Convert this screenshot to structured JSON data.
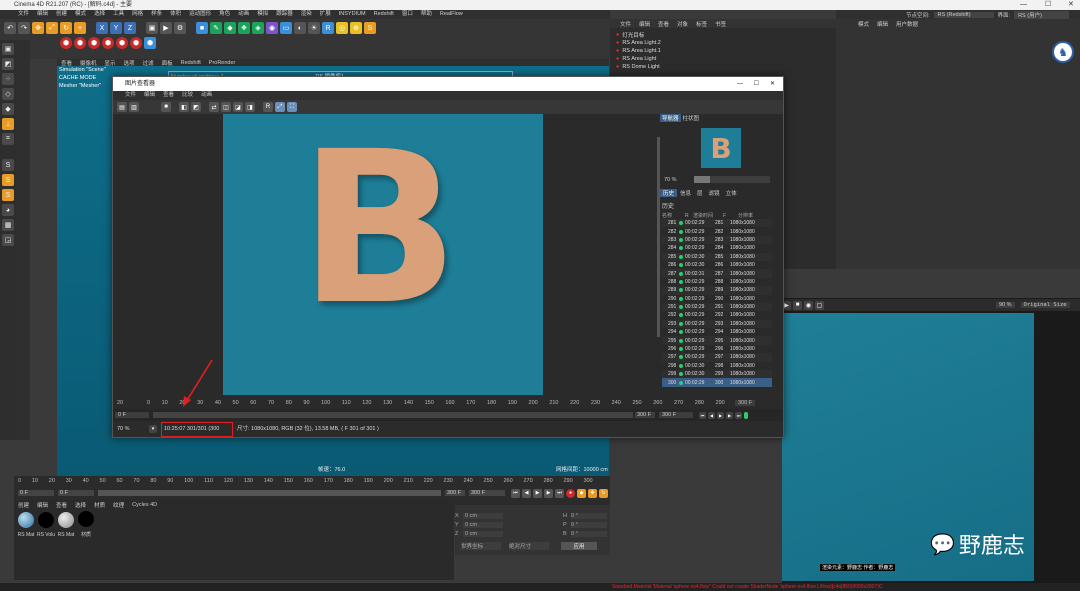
{
  "app": {
    "title": "Cinema 4D R21.207 (RC) - [解码.c4d] - 主要",
    "menus": [
      "文件",
      "编辑",
      "创建",
      "模式",
      "选择",
      "工具",
      "网格",
      "样条",
      "体积",
      "运动图形",
      "角色",
      "动画",
      "模拟",
      "跟踪器",
      "渲染",
      "扩展",
      "INSYDIUM",
      "Redshift",
      "窗口",
      "帮助",
      "RealFlow"
    ],
    "layout_label": "节点空间:",
    "layout_value": "RS (Redshift)",
    "interface_label": "界面:",
    "interface_value": "RS (用户)"
  },
  "viewport": {
    "menu": [
      "查看",
      "摄像机",
      "显示",
      "选项",
      "过滤",
      "面板",
      "Redshift",
      "ProRender"
    ],
    "info_lines": [
      "Simulation \"Scene\"",
      "CACHE MODE",
      "Mesher \"Mesher\""
    ],
    "overlay_emitters": "Number of emitters: 1",
    "overlay_cam": "RS 摄像机1",
    "speed": "帧速：76.0",
    "grid": "网格间距：10000 cm"
  },
  "timeline": {
    "ticks": [
      "0",
      "10",
      "20",
      "30",
      "40",
      "50",
      "60",
      "70",
      "80",
      "90",
      "100",
      "110",
      "120",
      "130",
      "140",
      "150",
      "160",
      "170",
      "180",
      "190",
      "200",
      "210",
      "220",
      "230",
      "240",
      "250",
      "260",
      "270",
      "280",
      "290",
      "300"
    ],
    "start": "0 F",
    "min": "0 F",
    "max": "300 F",
    "end": "300 F"
  },
  "materials": {
    "menu": [
      "创建",
      "编辑",
      "查看",
      "选择",
      "材质",
      "纹理",
      "Cycles 4D"
    ],
    "items": [
      "RS Mat",
      "RS Volu",
      "RS Mat",
      "材质"
    ]
  },
  "coords": {
    "labels": [
      "X",
      "Y",
      "Z"
    ],
    "values": [
      "0 cm",
      "0 cm",
      "0 cm"
    ],
    "size_labels": [
      "H",
      "P",
      "B"
    ],
    "size_values": [
      "0 °",
      "0 °",
      "0 °"
    ],
    "mode": "世界坐标",
    "scale": "绝对尺寸",
    "apply": "应用"
  },
  "objects": {
    "menu": [
      "文件",
      "编辑",
      "查看",
      "对象",
      "标签",
      "书签"
    ],
    "items": [
      "灯光目标",
      "RS Area Light.2",
      "RS Area Light.1",
      "RS Area Light",
      "RS Dome Light"
    ]
  },
  "attributes": {
    "menu": [
      "模式",
      "编辑",
      "用户数据"
    ]
  },
  "picture_viewer": {
    "title": "图片查看器",
    "menu": [
      "文件",
      "编辑",
      "查看",
      "比较",
      "动画"
    ],
    "zoom": "70 %",
    "side_tabs": [
      "导航器",
      "柱状图"
    ],
    "side_zoom": "70 %",
    "history_tabs": [
      "历史",
      "信息",
      "层",
      "滤镜",
      "立体"
    ],
    "history_label": "历史",
    "history_headers": [
      "名称",
      "R",
      "渲染时间",
      "F",
      "分辨率"
    ],
    "history": [
      {
        "id": "281",
        "time": "00:02:29",
        "f": "281",
        "res": "1080x1080"
      },
      {
        "id": "282",
        "time": "00:02:29",
        "f": "282",
        "res": "1080x1080"
      },
      {
        "id": "283",
        "time": "00:02:29",
        "f": "283",
        "res": "1080x1080"
      },
      {
        "id": "284",
        "time": "00:02:29",
        "f": "284",
        "res": "1080x1080"
      },
      {
        "id": "285",
        "time": "00:02:30",
        "f": "285",
        "res": "1080x1080"
      },
      {
        "id": "286",
        "time": "00:02:30",
        "f": "286",
        "res": "1080x1080"
      },
      {
        "id": "287",
        "time": "00:02:31",
        "f": "287",
        "res": "1080x1080"
      },
      {
        "id": "288",
        "time": "00:02:29",
        "f": "288",
        "res": "1080x1080"
      },
      {
        "id": "289",
        "time": "00:02:29",
        "f": "289",
        "res": "1080x1080"
      },
      {
        "id": "290",
        "time": "00:02:29",
        "f": "290",
        "res": "1080x1080"
      },
      {
        "id": "291",
        "time": "00:02:29",
        "f": "291",
        "res": "1080x1080"
      },
      {
        "id": "292",
        "time": "00:02:29",
        "f": "292",
        "res": "1080x1080"
      },
      {
        "id": "293",
        "time": "00:02:29",
        "f": "293",
        "res": "1080x1080"
      },
      {
        "id": "294",
        "time": "00:02:29",
        "f": "294",
        "res": "1080x1080"
      },
      {
        "id": "295",
        "time": "00:02:29",
        "f": "295",
        "res": "1080x1080"
      },
      {
        "id": "296",
        "time": "00:02:29",
        "f": "296",
        "res": "1080x1080"
      },
      {
        "id": "297",
        "time": "00:02:29",
        "f": "297",
        "res": "1080x1080"
      },
      {
        "id": "298",
        "time": "00:02:30",
        "f": "298",
        "res": "1080x1080"
      },
      {
        "id": "299",
        "time": "00:02:30",
        "f": "299",
        "res": "1080x1080"
      },
      {
        "id": "300",
        "time": "00:02:29",
        "f": "300",
        "res": "1080x1080"
      }
    ],
    "tl_ticks": [
      "0",
      "10",
      "20",
      "30",
      "40",
      "50",
      "60",
      "70",
      "80",
      "90",
      "100",
      "110",
      "120",
      "130",
      "140",
      "150",
      "160",
      "170",
      "180",
      "190",
      "200",
      "210",
      "220",
      "230",
      "240",
      "250",
      "260",
      "270",
      "280",
      "290"
    ],
    "tl_start": "20",
    "tl_end": "300 F",
    "frame_field": "0 F",
    "end_field": "300 F",
    "end_field2": "300 F",
    "status_zoom": "70 %",
    "status_time": "10:25:07 301/301 (300",
    "status_info": "尺寸: 1080x1080, RGB (32 位), 13.58 MB,  ( F 301 of 301 )",
    "letter": "B"
  },
  "render_view": {
    "zoom": "90 %",
    "mode": "Original Size",
    "caption": "渲染元素：野鹿志  作者：野鹿志"
  },
  "statusbar": "Standard.Material 'Material 'sphere ex4.flow'' Could not create ShaderNode 'sphere ex4.flow Liflow)[c4a]850(0000x2007)C",
  "watermark": "野鹿志",
  "colors": {
    "accent": "#3b5e86",
    "highlight": "#e02020",
    "viewport": "#0e6e8a"
  }
}
